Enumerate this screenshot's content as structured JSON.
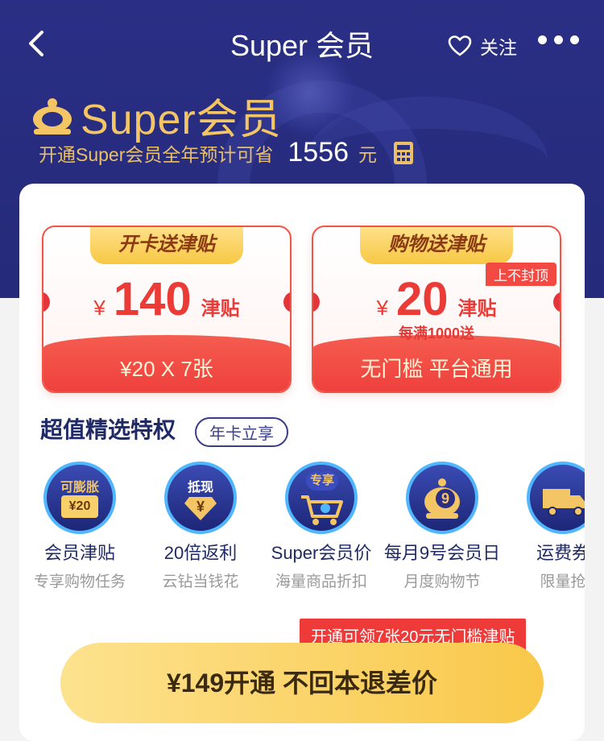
{
  "nav": {
    "title": "Super 会员",
    "follow_label": "关注"
  },
  "brand": {
    "logo_text": "Super会员"
  },
  "savings": {
    "text": "开通Super会员全年预计可省",
    "amount": "1556",
    "unit": "元"
  },
  "coupons": [
    {
      "ribbon": "开卡送津贴",
      "currency": "¥",
      "value": "140",
      "unit": "津贴",
      "condition": "",
      "cap_badge": "",
      "bottom": "¥20 X 7张"
    },
    {
      "ribbon": "购物送津贴",
      "currency": "¥",
      "value": "20",
      "unit": "津贴",
      "condition": "每满1000送",
      "cap_badge": "上不封顶",
      "bottom": "无门槛 平台通用"
    }
  ],
  "section": {
    "title": "超值精选特权",
    "tag": "年卡立享"
  },
  "perks": [
    {
      "title": "会员津贴",
      "subtitle": "专享购物任务",
      "icon": "allowance-ticket-icon",
      "badge": "可膨胀",
      "badge_value": "¥20"
    },
    {
      "title": "20倍返利",
      "subtitle": "云钻当钱花",
      "icon": "cashback-diamond-icon",
      "badge": "抵现",
      "badge_value": "¥"
    },
    {
      "title": "Super会员价",
      "subtitle": "海量商品折扣",
      "icon": "shopping-cart-icon",
      "badge": "专享",
      "badge_value": ""
    },
    {
      "title": "每月9号会员日",
      "subtitle": "月度购物节",
      "icon": "crown-nine-icon",
      "badge": "",
      "badge_value": "9"
    },
    {
      "title": "运费券",
      "subtitle": "限量抢",
      "icon": "truck-icon",
      "badge": "",
      "badge_value": ""
    }
  ],
  "promo": {
    "tag": "开通可领7张20元无门槛津贴"
  },
  "cta": {
    "label": "¥149开通  不回本退差价"
  },
  "colors": {
    "header_bg": "#2a2f85",
    "gold": "#f3c565",
    "red": "#ee3b39",
    "cta_yellow": "#f9c84a",
    "perk_navy": "#1f2a66"
  }
}
